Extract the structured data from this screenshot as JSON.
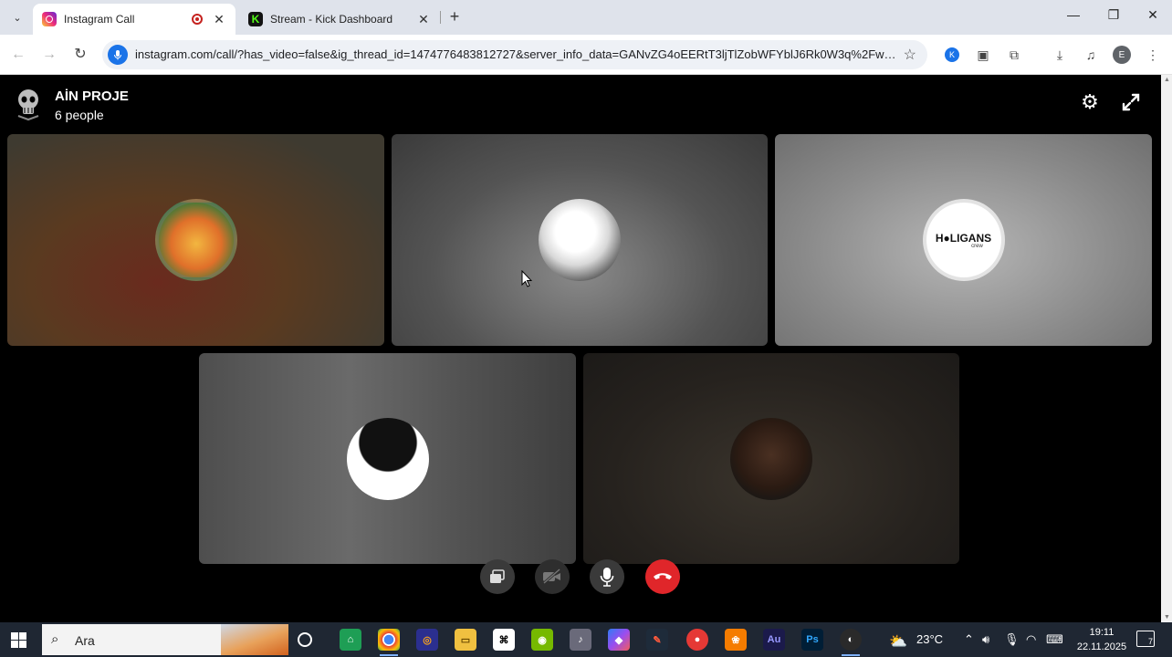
{
  "browser": {
    "tabs": [
      {
        "title": "Instagram Call",
        "active": true,
        "recording": true
      },
      {
        "title": "Stream - Kick Dashboard",
        "active": false
      }
    ],
    "url": "instagram.com/call/?has_video=false&ig_thread_id=1474776483812727&server_info_data=GANvZG4oEERtT3ljTlZobWFYblJ6Rk0W3q%2Fw5J...",
    "profile_initial": "E",
    "ext_label": "K"
  },
  "call": {
    "group_name": "AİN PROJE",
    "participant_count": "6 people",
    "participants": [
      {
        "label": "participant-1"
      },
      {
        "label": "participant-2"
      },
      {
        "label": "participant-3",
        "logo_text": "H●LIGANS",
        "logo_sub": "crew"
      },
      {
        "label": "participant-4"
      },
      {
        "label": "participant-5"
      }
    ],
    "colors": {
      "end_call": "#e0262a"
    }
  },
  "taskbar": {
    "search_placeholder": "Ara",
    "temperature": "23°C",
    "time": "19:11",
    "date": "22.11.2025",
    "notification_count": "7",
    "apps": [
      "Au",
      "Ps"
    ]
  }
}
